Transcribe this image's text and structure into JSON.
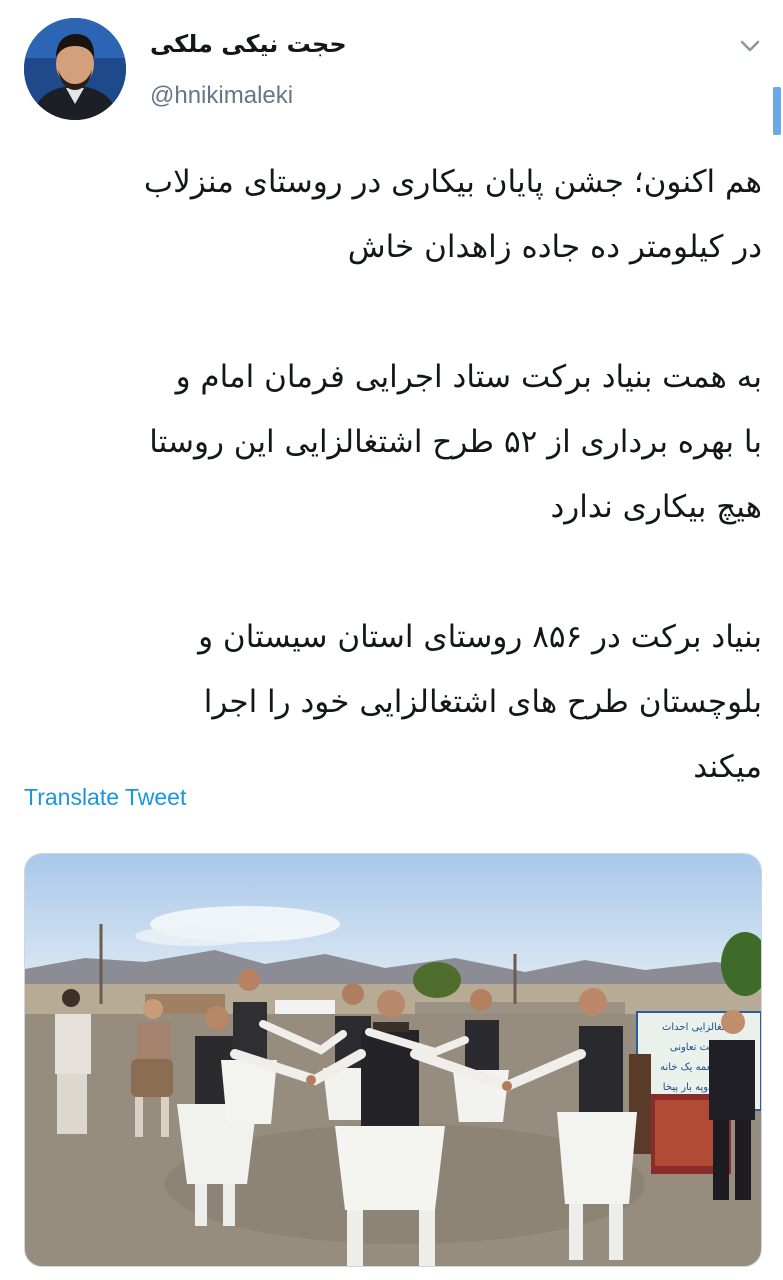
{
  "tweet": {
    "author": {
      "name": "حجت نیکی ملکی",
      "handle": "@hnikimaleki"
    },
    "text": {
      "p1": [
        "هم اکنون؛ جشن پایان بیکاری در روستای منزلاب",
        "در کیلومتر ده جاده زاهدان خاش"
      ],
      "p2": [
        "به همت بنیاد برکت ستاد اجرایی فرمان امام و",
        "با بهره برداری از ۵۲ طرح اشتغالزایی این روستا",
        "هیچ بیکاری ندارد"
      ],
      "p3": [
        "بنیاد برکت در ۸۵۶ روستای استان سیستان و",
        "بلوچستان طرح های اشتغالزایی خود را اجرا",
        "میکند"
      ]
    },
    "translate_label": "Translate Tweet",
    "menu_icon": "chevron-down-icon",
    "accent_color": "#1b95e0",
    "media": {
      "banner_lines": [
        "اشتغالزایی احداث",
        "شرکت تعاونی",
        "یوروا نعمه یک خانه",
        "شمه دوپه بار پیخا"
      ]
    }
  }
}
